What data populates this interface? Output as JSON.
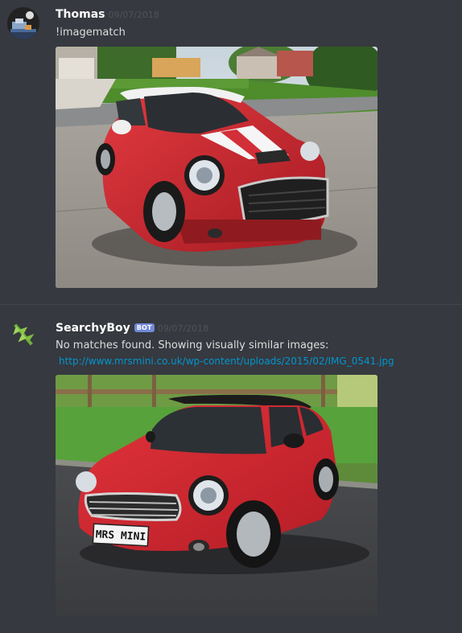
{
  "messages": [
    {
      "author": "Thomas",
      "timestamp": "09/07/2018",
      "text": "!imagematch"
    },
    {
      "author": "SearchyBoy",
      "bot_tag": "BOT",
      "timestamp": "09/07/2018",
      "text": "No matches found. Showing visually similar images:",
      "link": "http://www.mrsmini.co.uk/wp-content/uploads/2015/02/IMG_0541.jpg",
      "plate": "MRS MINI"
    }
  ],
  "colors": {
    "background": "#36393f",
    "username": "#ffffff",
    "timestamp": "#4f535b",
    "link": "#0096cf",
    "bot_tag": "#7289da",
    "car_red": "#d6303a"
  },
  "icons": {
    "thomas_avatar": "pixel-art-avatar-icon",
    "searchyboy_avatar": "leaf-icon"
  }
}
